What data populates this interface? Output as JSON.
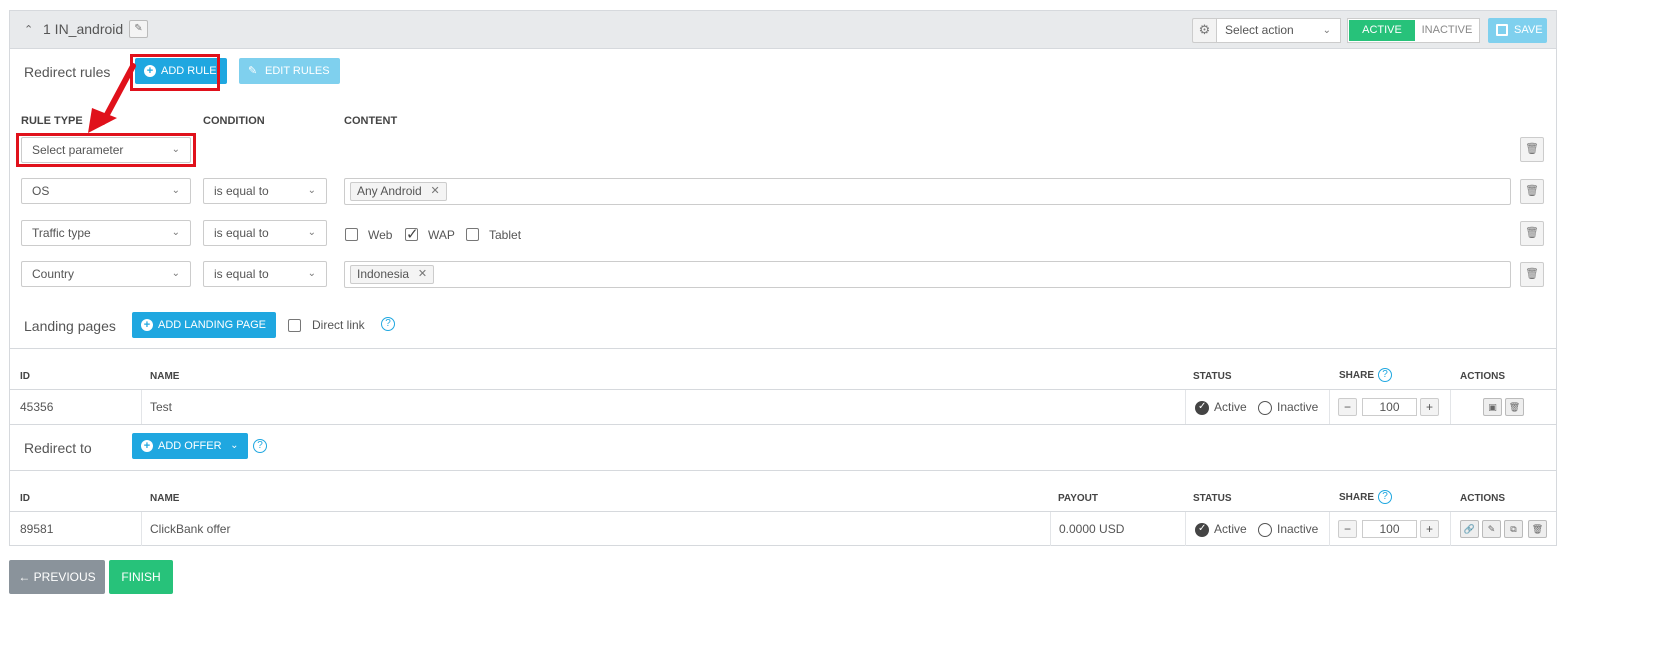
{
  "header": {
    "collapse_icon": "chevron-up-icon",
    "flow_title": "1 IN_android",
    "edit_icon": "pencil-icon",
    "settings_icon": "gears-icon",
    "select_action": "Select action",
    "toggle_active": "ACTIVE",
    "toggle_inactive": "INACTIVE",
    "save_label": "SAVE"
  },
  "redirect_rules": {
    "title": "Redirect rules",
    "add_rule_label": "ADD RULE",
    "edit_rules_label": "EDIT RULES",
    "columns": {
      "rule_type": "RULE TYPE",
      "condition": "CONDITION",
      "content": "CONTENT"
    },
    "new_rule_placeholder": "Select parameter",
    "rules": [
      {
        "type": "OS",
        "condition": "is equal to",
        "tag": "Any Android"
      },
      {
        "type": "Traffic type",
        "condition": "is equal to",
        "options": [
          "Web",
          "WAP",
          "Tablet"
        ],
        "checked": [
          false,
          true,
          false
        ]
      },
      {
        "type": "Country",
        "condition": "is equal to",
        "tag": "Indonesia"
      }
    ]
  },
  "landing_pages": {
    "title": "Landing pages",
    "add_label": "ADD LANDING PAGE",
    "direct_link_label": "Direct link",
    "columns": {
      "id": "ID",
      "name": "NAME",
      "status": "STATUS",
      "share": "SHARE",
      "actions": "ACTIONS"
    },
    "rows": [
      {
        "id": "45356",
        "name": "Test",
        "status_active": "Active",
        "status_inactive": "Inactive",
        "selected": "Active",
        "share": "100"
      }
    ]
  },
  "redirect_to": {
    "title": "Redirect to",
    "add_offer_label": "ADD OFFER",
    "columns": {
      "id": "ID",
      "name": "NAME",
      "payout": "PAYOUT",
      "status": "STATUS",
      "share": "SHARE",
      "actions": "ACTIONS"
    },
    "rows": [
      {
        "id": "89581",
        "name": "ClickBank offer",
        "payout": "0.0000 USD",
        "status_active": "Active",
        "status_inactive": "Inactive",
        "selected": "Active",
        "share": "100"
      }
    ]
  },
  "footer": {
    "previous_label": "← PREVIOUS",
    "finish_label": "FINISH"
  },
  "colors": {
    "accent_blue": "#1fa7e0",
    "active_green": "#27c27a",
    "annotation_red": "#e0111b",
    "header_bg": "#e8eaec"
  }
}
